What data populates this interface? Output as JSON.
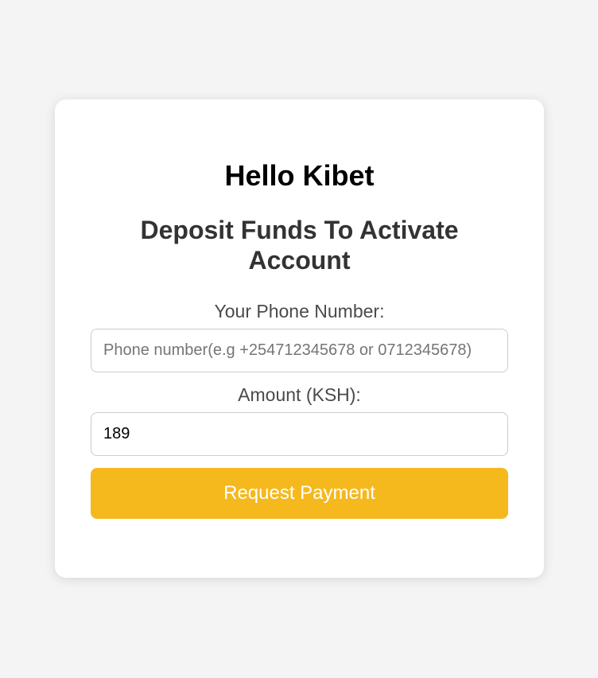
{
  "greeting": "Hello Kibet",
  "subtitle": "Deposit Funds To Activate Account",
  "form": {
    "phone_label": "Your Phone Number:",
    "phone_placeholder": "Phone number(e.g +254712345678 or 0712345678)",
    "phone_value": "",
    "amount_label": "Amount (KSH):",
    "amount_value": "189",
    "submit_label": "Request Payment"
  },
  "colors": {
    "accent": "#f5b91e",
    "background": "#f4f4f4",
    "card": "#ffffff"
  }
}
